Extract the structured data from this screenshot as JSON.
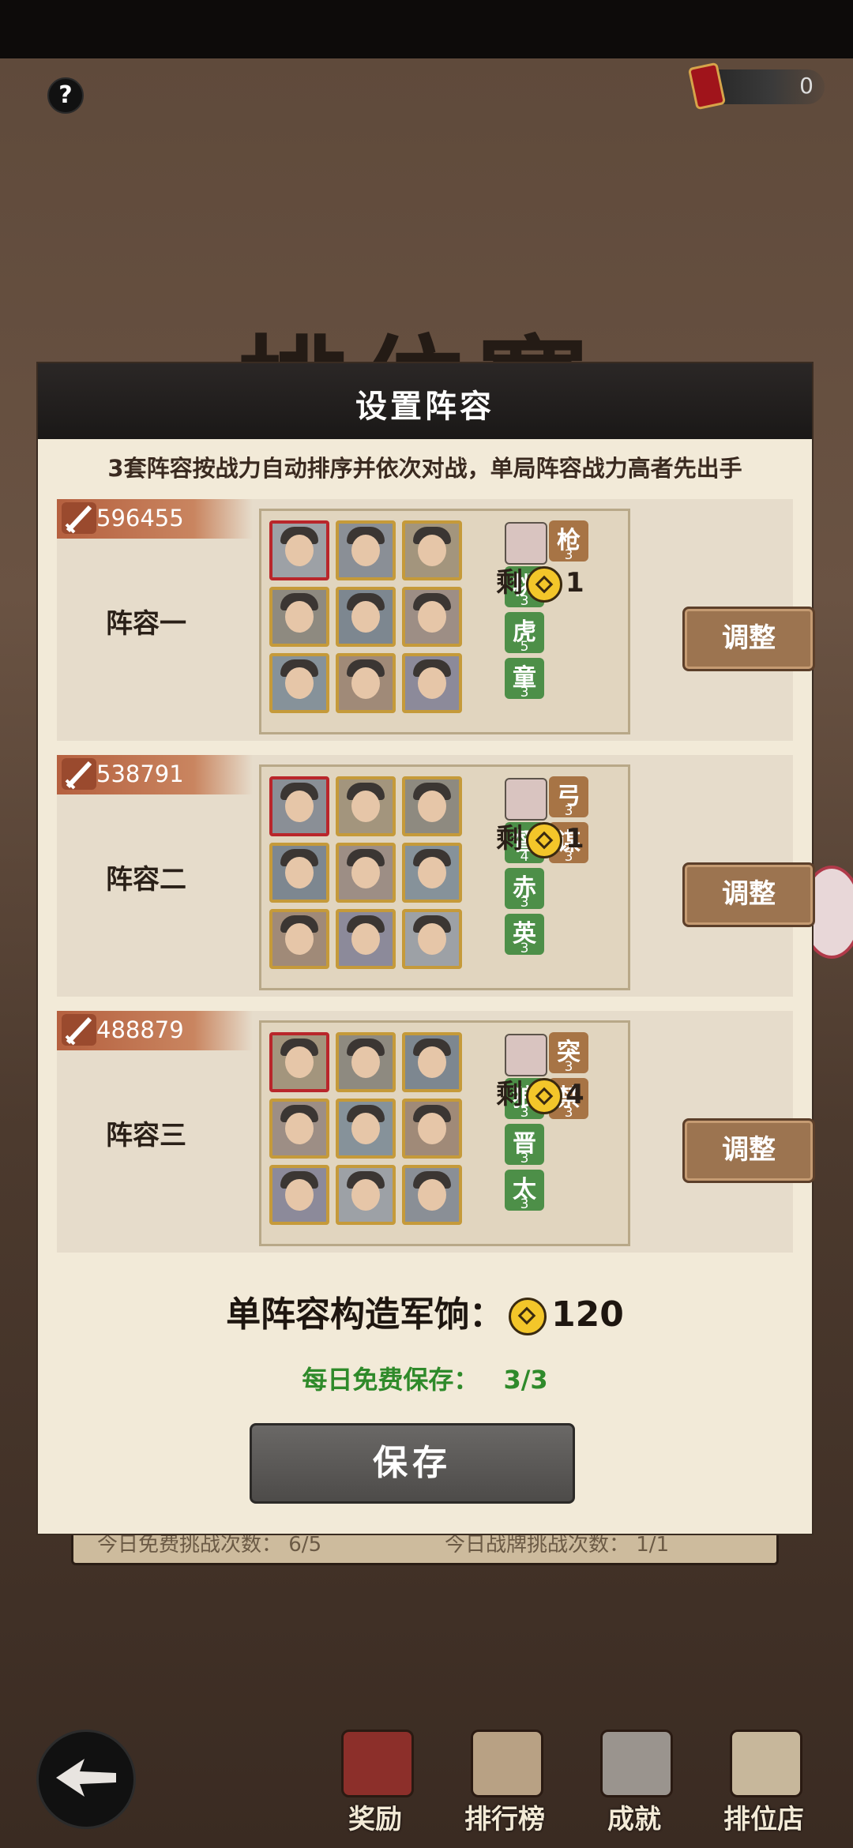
{
  "background": {
    "title": "排位赛",
    "currency_value": "0",
    "free_challenge": "今日免费挑战次数：  6/5",
    "flag_challenge": "今日战牌挑战次数：  1/1"
  },
  "nav": {
    "items": [
      {
        "label": "奖励"
      },
      {
        "label": "排行榜"
      },
      {
        "label": "成就"
      },
      {
        "label": "排位店"
      }
    ]
  },
  "modal": {
    "title": "设置阵容",
    "hint": "3套阵容按战力自动排序并依次对战，单局阵容战力高者先出手",
    "lineups": [
      {
        "power": "596455",
        "name": "阵容一",
        "remain_prefix": "剩",
        "remain": "1",
        "adjust": "调整",
        "tags": [
          {
            "text": "枪",
            "num": "3",
            "color": "brown"
          },
          {
            "text": "桃",
            "num": "3",
            "color": "green"
          },
          {
            "text": "虎",
            "num": "5",
            "color": "green"
          },
          {
            "text": "童",
            "num": "3",
            "color": "green"
          }
        ]
      },
      {
        "power": "538791",
        "name": "阵容二",
        "remain_prefix": "剩",
        "remain": "1",
        "adjust": "调整",
        "tags": [
          {
            "text": "弓",
            "num": "3",
            "color": "brown"
          },
          {
            "text": "督",
            "num": "4",
            "color": "green"
          },
          {
            "text": "谋",
            "num": "3",
            "color": "brown"
          },
          {
            "text": "赤",
            "num": "3",
            "color": "green"
          },
          {
            "text": "英",
            "num": "3",
            "color": "green"
          }
        ]
      },
      {
        "power": "488879",
        "name": "阵容三",
        "remain_prefix": "剩",
        "remain": "4",
        "adjust": "调整",
        "tags": [
          {
            "text": "突",
            "num": "3",
            "color": "brown"
          },
          {
            "text": "狼",
            "num": "3",
            "color": "green"
          },
          {
            "text": "禁",
            "num": "3",
            "color": "brown"
          },
          {
            "text": "晋",
            "num": "3",
            "color": "green"
          },
          {
            "text": "太",
            "num": "3",
            "color": "green"
          }
        ]
      }
    ],
    "cost_label": "单阵容构造军饷：",
    "cost_value": "120",
    "free_save_label": "每日免费保存：",
    "free_save_value": "3/3",
    "save_button": "保存"
  }
}
